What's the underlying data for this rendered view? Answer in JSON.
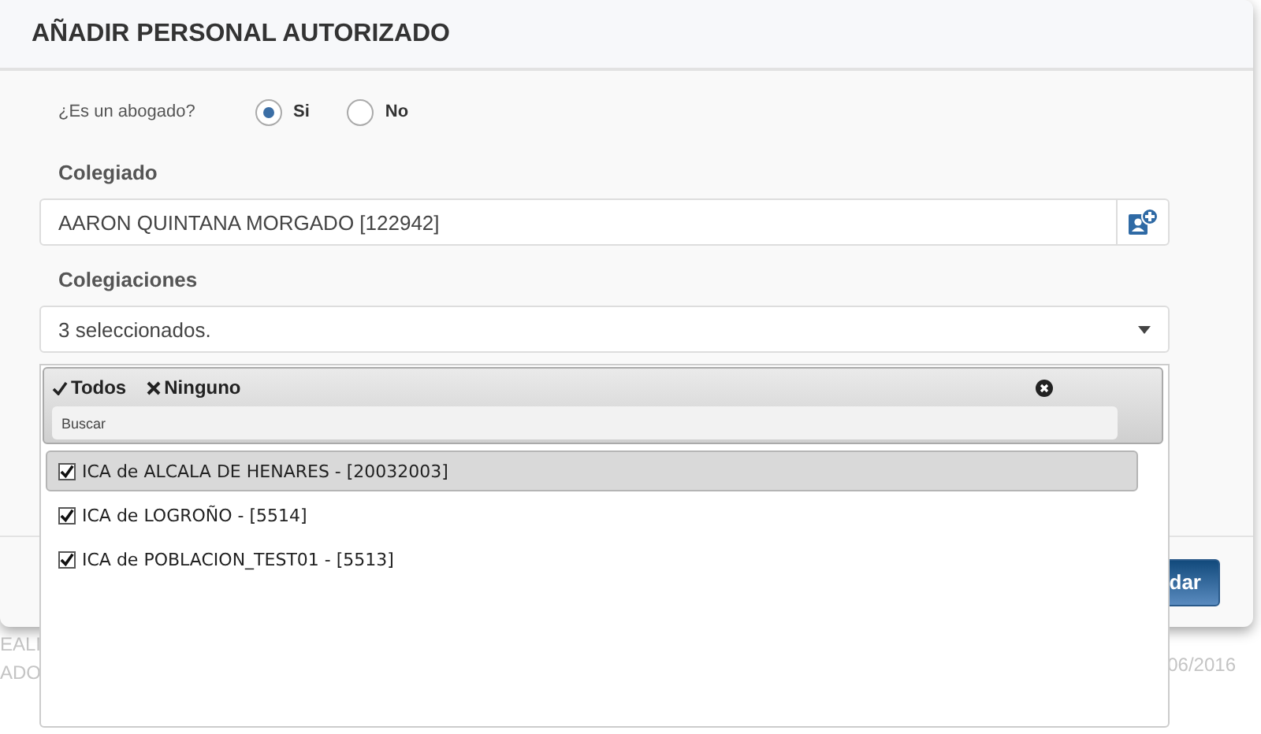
{
  "background": {
    "left_texts": [
      "EALI",
      "ADO"
    ],
    "right_text": "06/2016"
  },
  "modal": {
    "title": "AÑADIR PERSONAL AUTORIZADO",
    "lawyer_question": {
      "label": "¿Es un abogado?",
      "options": [
        {
          "label": "Si",
          "selected": true
        },
        {
          "label": "No",
          "selected": false
        }
      ]
    },
    "colegiado": {
      "label": "Colegiado",
      "value": "AARON QUINTANA MORGADO [122942]"
    },
    "colegiaciones": {
      "label": "Colegiaciones",
      "value": "3 seleccionados."
    },
    "footer_button": "dar"
  },
  "dropdown": {
    "select_all": "Todos",
    "select_none": "Ninguno",
    "search": {
      "placeholder": "Buscar"
    },
    "items": [
      {
        "label": "ICA de ALCALA DE HENARES - [20032003]",
        "checked": true,
        "selected": true
      },
      {
        "label": "ICA de LOGROÑO - [5514]",
        "checked": true,
        "selected": false
      },
      {
        "label": "ICA de POBLACION_TEST01 - [5513]",
        "checked": true,
        "selected": false
      }
    ]
  }
}
